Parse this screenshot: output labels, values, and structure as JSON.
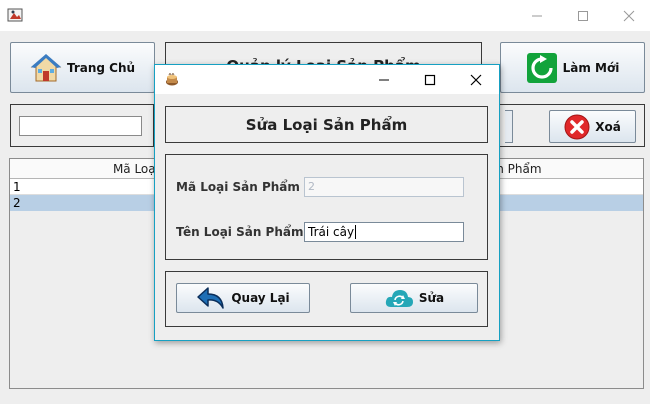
{
  "main": {
    "home_label": "Trang Chủ",
    "title": "Quản lý Loại Sản Phẩm",
    "refresh_label": "Làm Mới",
    "delete_label": "Xoá",
    "search_value": "",
    "table": {
      "columns": [
        "Mã Loại Sản Phẩm",
        "Tên Loại Sản Phẩm"
      ],
      "rows": [
        [
          "1",
          ""
        ],
        [
          "2",
          ""
        ]
      ],
      "header_left_visible": "Mã Loại",
      "header_right_visible": "Phẩm"
    }
  },
  "dialog": {
    "title": "Sửa Loại Sản Phẩm",
    "code_label": "Mã Loại Sản Phẩm",
    "code_value": "2",
    "name_label": "Tên Loại Sản Phẩm",
    "name_value": "Trái cây",
    "back_label": "Quay Lại",
    "edit_label": "Sửa"
  },
  "icons": {
    "app": "coffee-cup-icon",
    "home": "house-icon",
    "refresh": "refresh-arrow-icon",
    "delete": "red-x-icon",
    "back": "back-arrow-icon",
    "edit": "sync-cloud-icon"
  },
  "colors": {
    "dialog_border": "#16a0c2",
    "selected_row": "#b8cfe5",
    "refresh_green": "#12a33b",
    "delete_red": "#e0282a"
  }
}
